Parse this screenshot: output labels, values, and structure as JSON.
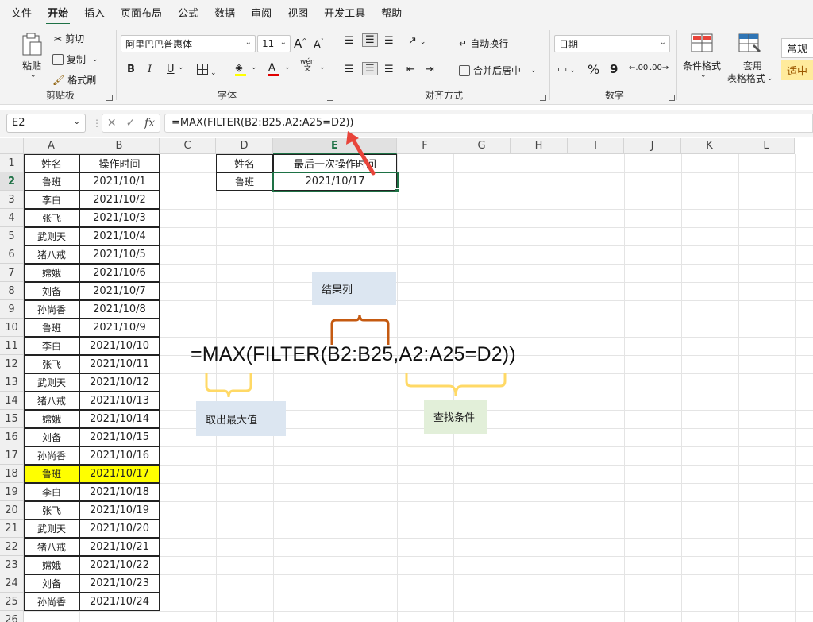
{
  "menu": [
    "文件",
    "开始",
    "插入",
    "页面布局",
    "公式",
    "数据",
    "审阅",
    "视图",
    "开发工具",
    "帮助"
  ],
  "menu_active": "开始",
  "ribbon": {
    "clipboard": {
      "paste": "粘贴",
      "cut": "剪切",
      "copy": "复制",
      "format_painter": "格式刷",
      "label": "剪贴板"
    },
    "font": {
      "name": "阿里巴巴普惠体",
      "size": "11",
      "grow": "A",
      "shrink": "A",
      "bold": "B",
      "italic": "I",
      "underline": "U",
      "label": "字体",
      "phonetic": "wén"
    },
    "alignment": {
      "wrap": "自动换行",
      "merge": "合并后居中",
      "label": "对齐方式"
    },
    "number": {
      "format": "日期",
      "percent": "%",
      "comma": "9",
      "inc": ".00",
      "dec": ".00",
      "label": "数字"
    },
    "styles": {
      "conditional": "条件格式",
      "table1": "套用",
      "table2": "表格格式",
      "normal": "常规",
      "neutral": "适中"
    }
  },
  "formula_bar": {
    "name_box": "E2",
    "fx": "fx",
    "formula": "=MAX(FILTER(B2:B25,A2:A25=D2))"
  },
  "columns": [
    "A",
    "B",
    "C",
    "D",
    "E",
    "F",
    "G",
    "H",
    "I",
    "J",
    "K",
    "L"
  ],
  "selected_column": "E",
  "selected_row": "2",
  "rows": [
    "1",
    "2",
    "3",
    "4",
    "5",
    "6",
    "7",
    "8",
    "9",
    "10",
    "11",
    "12",
    "13",
    "14",
    "15",
    "16",
    "17",
    "18",
    "19",
    "20",
    "21",
    "22",
    "23",
    "24",
    "25",
    "26"
  ],
  "table": {
    "headers": [
      "姓名",
      "操作时间"
    ],
    "rows": [
      [
        "鲁班",
        "2021/10/1"
      ],
      [
        "李白",
        "2021/10/2"
      ],
      [
        "张飞",
        "2021/10/3"
      ],
      [
        "武则天",
        "2021/10/4"
      ],
      [
        "猪八戒",
        "2021/10/5"
      ],
      [
        "嫦娥",
        "2021/10/6"
      ],
      [
        "刘备",
        "2021/10/7"
      ],
      [
        "孙尚香",
        "2021/10/8"
      ],
      [
        "鲁班",
        "2021/10/9"
      ],
      [
        "李白",
        "2021/10/10"
      ],
      [
        "张飞",
        "2021/10/11"
      ],
      [
        "武则天",
        "2021/10/12"
      ],
      [
        "猪八戒",
        "2021/10/13"
      ],
      [
        "嫦娥",
        "2021/10/14"
      ],
      [
        "刘备",
        "2021/10/15"
      ],
      [
        "孙尚香",
        "2021/10/16"
      ],
      [
        "鲁班",
        "2021/10/17"
      ],
      [
        "李白",
        "2021/10/18"
      ],
      [
        "张飞",
        "2021/10/19"
      ],
      [
        "武则天",
        "2021/10/20"
      ],
      [
        "猪八戒",
        "2021/10/21"
      ],
      [
        "嫦娥",
        "2021/10/22"
      ],
      [
        "刘备",
        "2021/10/23"
      ],
      [
        "孙尚香",
        "2021/10/24"
      ]
    ],
    "highlight_row": 17,
    "highlight_color": "#ffff00"
  },
  "lookup": {
    "header_name": "姓名",
    "header_result": "最后一次操作时间",
    "name": "鲁班",
    "result": "2021/10/17"
  },
  "annotation": {
    "formula": "=MAX(FILTER(B2:B25,A2:A25=D2))",
    "result_col": "结果列",
    "take_max": "取出最大值",
    "condition": "查找条件",
    "brace_color_orange": "#c55a11",
    "brace_color_yellow": "#ffd966",
    "arrow_color": "#e8443a"
  },
  "accent_color": "#1e7145"
}
